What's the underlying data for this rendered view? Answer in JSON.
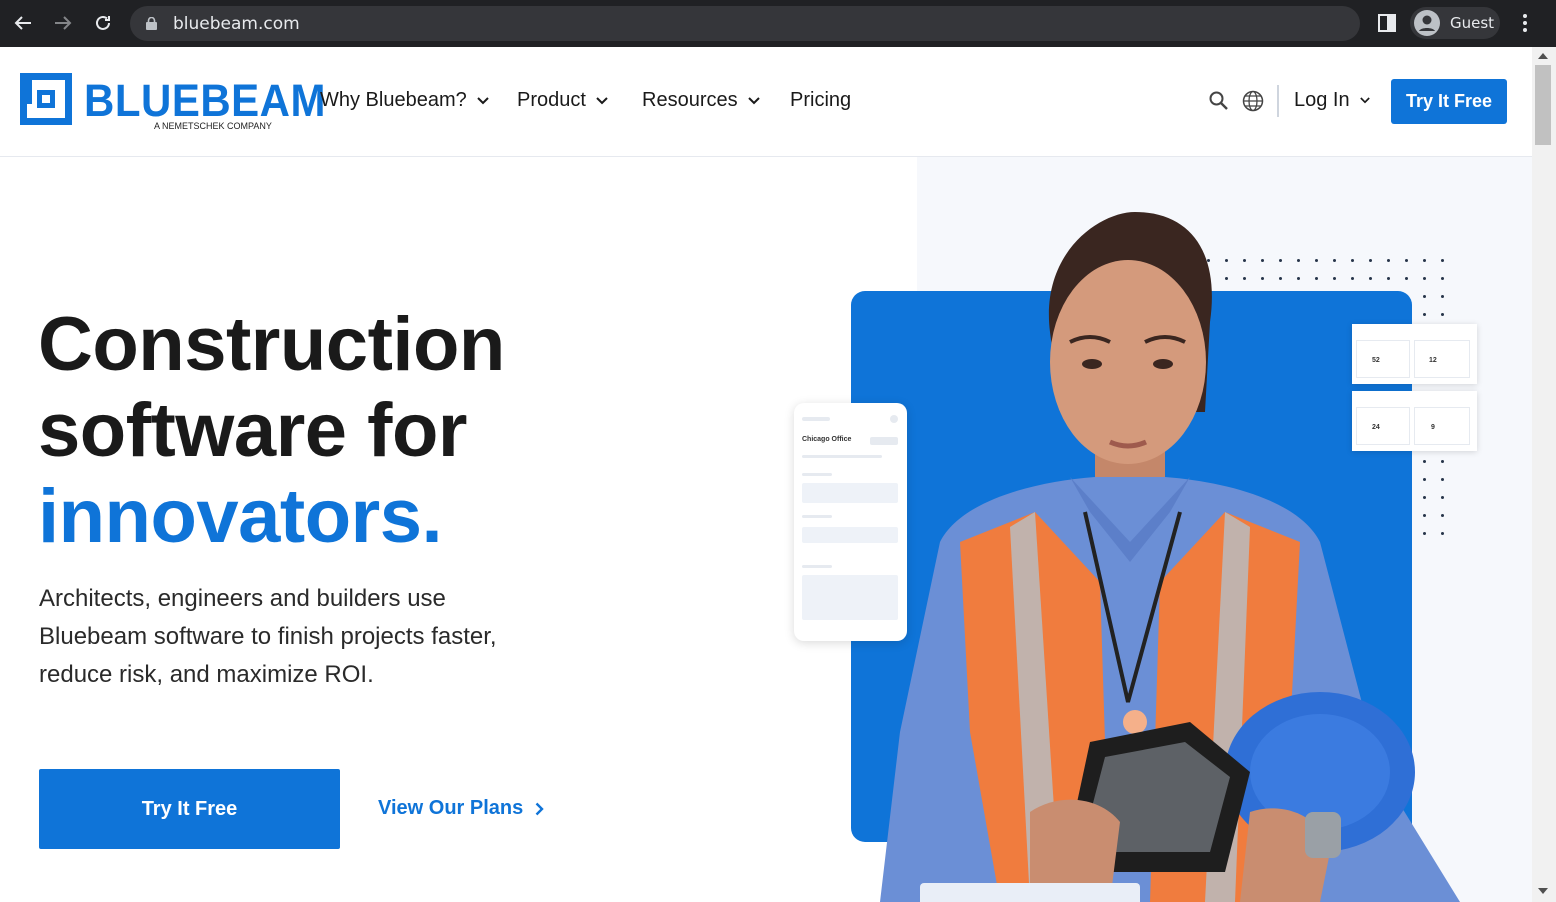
{
  "browser": {
    "url": "bluebeam.com",
    "profile_name": "Guest"
  },
  "header": {
    "logo_text": "BLUEBEAM",
    "logo_subtext": "A NEMETSCHEK COMPANY",
    "nav": [
      {
        "label": "Why Bluebeam?",
        "has_dropdown": true
      },
      {
        "label": "Product",
        "has_dropdown": true
      },
      {
        "label": "Resources",
        "has_dropdown": true
      },
      {
        "label": "Pricing",
        "has_dropdown": false
      }
    ],
    "login_label": "Log In",
    "cta_label": "Try It Free"
  },
  "hero": {
    "headline_line1": "Construction",
    "headline_line2": "software for",
    "headline_accent": "innovators.",
    "subtext": "Architects, engineers and builders use Bluebeam software to finish projects faster, reduce risk, and maximize ROI.",
    "primary_cta": "Try It Free",
    "secondary_cta": "View Our Plans"
  },
  "illustration": {
    "phone_title": "Chicago Office",
    "card_values": [
      "52",
      "12",
      "24",
      "9"
    ]
  },
  "colors": {
    "brand_blue": "#0f74d8",
    "text_dark": "#1a1a1a",
    "chrome_bg": "#202124"
  }
}
